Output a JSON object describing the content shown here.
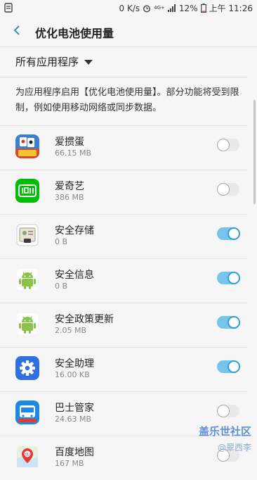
{
  "status": {
    "speed": "0 K/s",
    "net": "4G+",
    "battery": "12%",
    "time": "上午 11:26"
  },
  "header": {
    "title": "优化电池使用量"
  },
  "filter": {
    "label": "所有应用程序"
  },
  "description": "为应用程序启用【优化电池使用量】。部分功能将受到限制，例如使用移动网络或同步数据。",
  "apps": [
    {
      "name": "爱掼蛋",
      "size": "66.15 MB",
      "on": false,
      "icon": "poker-game-icon"
    },
    {
      "name": "爱奇艺",
      "size": "386 MB",
      "on": false,
      "icon": "iqiyi-icon"
    },
    {
      "name": "安全存储",
      "size": "0 B",
      "on": true,
      "icon": "secure-storage-icon"
    },
    {
      "name": "安全信息",
      "size": "0 B",
      "on": true,
      "icon": "android-icon"
    },
    {
      "name": "安全政策更新",
      "size": "2.05 MB",
      "on": true,
      "icon": "android-icon"
    },
    {
      "name": "安全助理",
      "size": "16.00 KB",
      "on": true,
      "icon": "gear-icon"
    },
    {
      "name": "巴士管家",
      "size": "24.63 MB",
      "on": false,
      "icon": "bus-icon"
    },
    {
      "name": "百度地图",
      "size": "167 MB",
      "on": false,
      "icon": "baidu-map-icon"
    }
  ],
  "watermark": {
    "line1": "盖乐世社区",
    "line2": "@翠西李"
  },
  "colors": {
    "toggle_on": "#2e9fd9",
    "toggle_off": "#a8a8a8"
  }
}
